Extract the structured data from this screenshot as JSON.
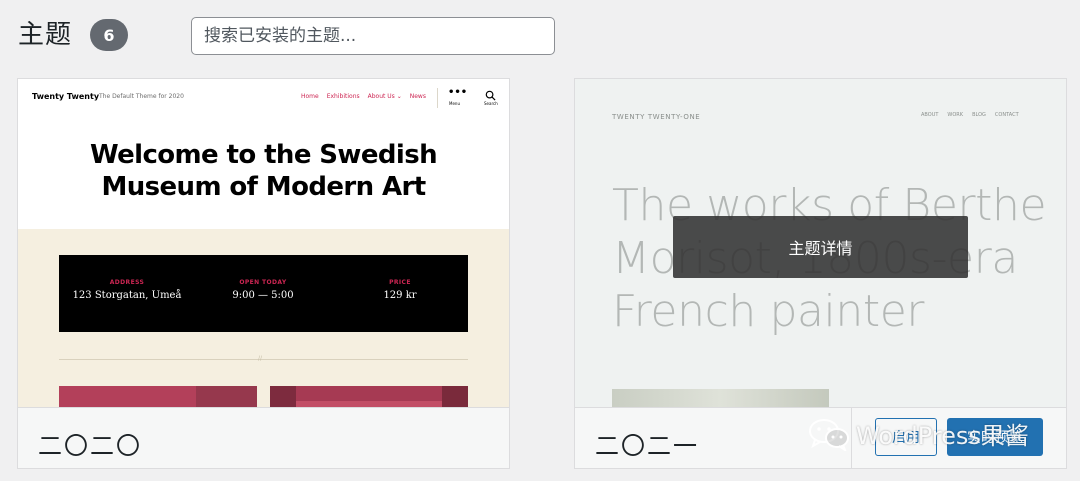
{
  "header": {
    "title": "主题",
    "count": "6",
    "search_placeholder": "搜索已安装的主题..."
  },
  "themes": [
    {
      "name": "二〇二〇",
      "preview": {
        "site_title": "Twenty Twenty",
        "site_description": "The Default Theme for 2020",
        "nav": [
          "Home",
          "Exhibitions",
          "About Us ⌄",
          "News"
        ],
        "menu_label": "Menu",
        "search_label": "Search",
        "headline_line1": "Welcome to the Swedish",
        "headline_line2": "Museum of Modern Art",
        "info": [
          {
            "label": "ADDRESS",
            "value": "123 Storgatan, Umeå"
          },
          {
            "label": "OPEN TODAY",
            "value": "9:00 — 5:00"
          },
          {
            "label": "PRICE",
            "value": "129 kr"
          }
        ],
        "accent_color": "#cd2653",
        "background_color": "#f5efe0"
      }
    },
    {
      "name": "二〇二一",
      "preview": {
        "site_title": "TWENTY TWENTY-ONE",
        "nav": [
          "ABOUT",
          "WORK",
          "BLOG",
          "CONTACT"
        ],
        "heading": "The works of Berthe Morisot, 1800s-era French painter",
        "background_color": "#eff2f1"
      },
      "details_label": "主题详情",
      "activate_label": "启用",
      "preview_label": "实时预览"
    }
  ],
  "watermark": {
    "icon": "wechat-icon",
    "text": "WordPress果酱"
  },
  "colors": {
    "badge": "#646970",
    "primary_button": "#2271b1"
  }
}
